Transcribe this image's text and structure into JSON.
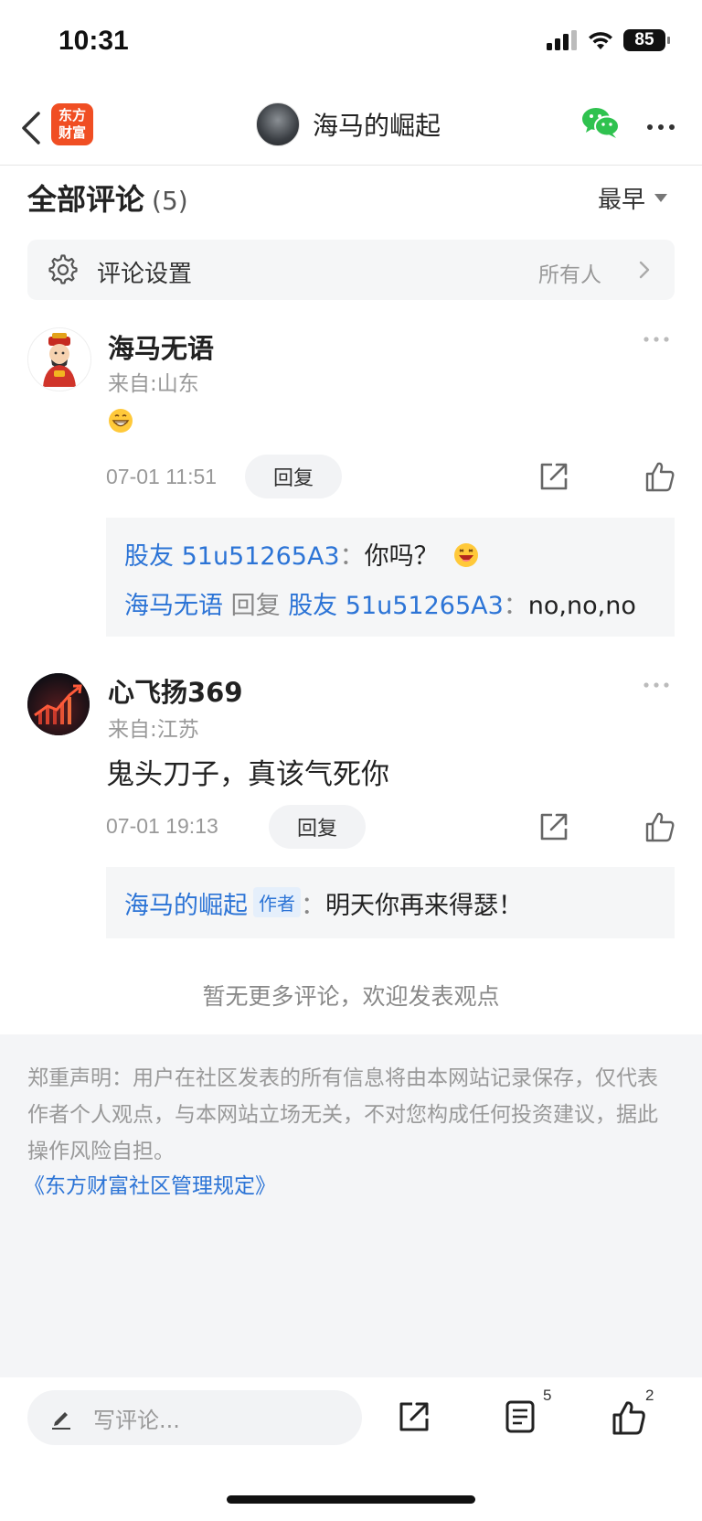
{
  "status_bar": {
    "time": "10:31",
    "battery": "85"
  },
  "nav": {
    "logo_line1": "东方",
    "logo_line2": "财富",
    "title": "海马的崛起"
  },
  "comments_header": {
    "title": "全部评论",
    "count": "(5)",
    "sort_label": "最早"
  },
  "settings_row": {
    "label": "评论设置",
    "value": "所有人"
  },
  "comments": [
    {
      "username": "海马无语",
      "location": "来自:山东",
      "time": "07-01 11:51",
      "reply_label": "回复",
      "replies": [
        {
          "user": "股友 51u51265A3",
          "separator": "：",
          "text": "你吗？"
        },
        {
          "user": "海马无语",
          "reply_word": "回复",
          "target": "股友 51u51265A3",
          "separator": "：",
          "text": "no,no,no"
        }
      ]
    },
    {
      "username": "心飞扬369",
      "location": "来自:江苏",
      "text": "鬼头刀子，真该气死你",
      "time": "07-01 19:13",
      "reply_label": "回复",
      "replies": [
        {
          "user": "海马的崛起",
          "author_tag": "作者",
          "separator": "：",
          "text": "明天你再来得瑟！"
        }
      ]
    }
  ],
  "no_more_text": "暂无更多评论，欢迎发表观点",
  "disclaimer": {
    "text": "郑重声明：用户在社区发表的所有信息将由本网站记录保存，仅代表作者个人观点，与本网站立场无关，不对您构成任何投资建议，据此操作风险自担。",
    "link": "《东方财富社区管理规定》"
  },
  "bottom_bar": {
    "input_placeholder": "写评论...",
    "comment_count": "5",
    "like_count": "2"
  },
  "colors": {
    "accent_blue": "#2c74d6",
    "logo_orange": "#f04e23",
    "wechat_green": "#2fc24f"
  }
}
